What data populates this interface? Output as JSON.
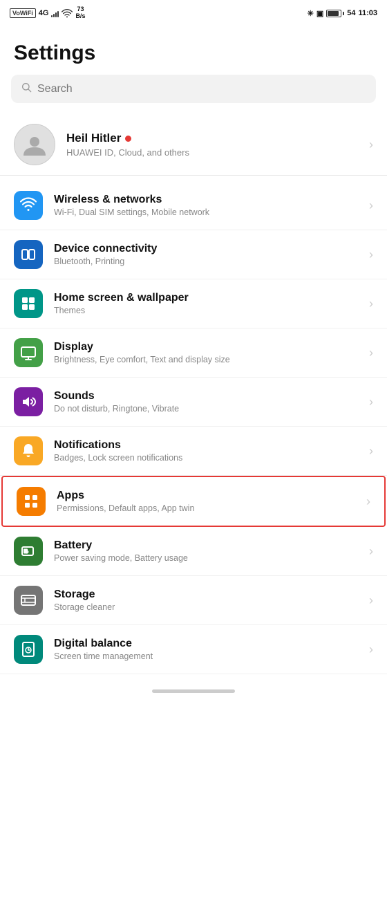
{
  "statusBar": {
    "carrier": "VoWiFi",
    "signal": "4G",
    "wifi": "WiFi",
    "speed": "73\nB/s",
    "bluetooth": "BT",
    "battery": "54",
    "time": "11:03"
  },
  "page": {
    "title": "Settings"
  },
  "search": {
    "placeholder": "Search"
  },
  "profile": {
    "name": "Heil Hitler",
    "dot": "●",
    "subtitle": "HUAWEI ID, Cloud, and others"
  },
  "settings": [
    {
      "id": "wireless",
      "title": "Wireless & networks",
      "subtitle": "Wi-Fi, Dual SIM settings, Mobile network",
      "iconColor": "icon-blue",
      "highlighted": false
    },
    {
      "id": "device-connectivity",
      "title": "Device connectivity",
      "subtitle": "Bluetooth, Printing",
      "iconColor": "icon-blue-dark",
      "highlighted": false
    },
    {
      "id": "home-screen",
      "title": "Home screen & wallpaper",
      "subtitle": "Themes",
      "iconColor": "icon-teal",
      "highlighted": false
    },
    {
      "id": "display",
      "title": "Display",
      "subtitle": "Brightness, Eye comfort, Text and display size",
      "iconColor": "icon-green-light",
      "highlighted": false
    },
    {
      "id": "sounds",
      "title": "Sounds",
      "subtitle": "Do not disturb, Ringtone, Vibrate",
      "iconColor": "icon-purple",
      "highlighted": false
    },
    {
      "id": "notifications",
      "title": "Notifications",
      "subtitle": "Badges, Lock screen notifications",
      "iconColor": "icon-yellow",
      "highlighted": false
    },
    {
      "id": "apps",
      "title": "Apps",
      "subtitle": "Permissions, Default apps, App twin",
      "iconColor": "icon-orange",
      "highlighted": true
    },
    {
      "id": "battery",
      "title": "Battery",
      "subtitle": "Power saving mode, Battery usage",
      "iconColor": "icon-green",
      "highlighted": false
    },
    {
      "id": "storage",
      "title": "Storage",
      "subtitle": "Storage cleaner",
      "iconColor": "icon-gray",
      "highlighted": false
    },
    {
      "id": "digital-balance",
      "title": "Digital balance",
      "subtitle": "Screen time management",
      "iconColor": "icon-teal2",
      "highlighted": false
    }
  ]
}
